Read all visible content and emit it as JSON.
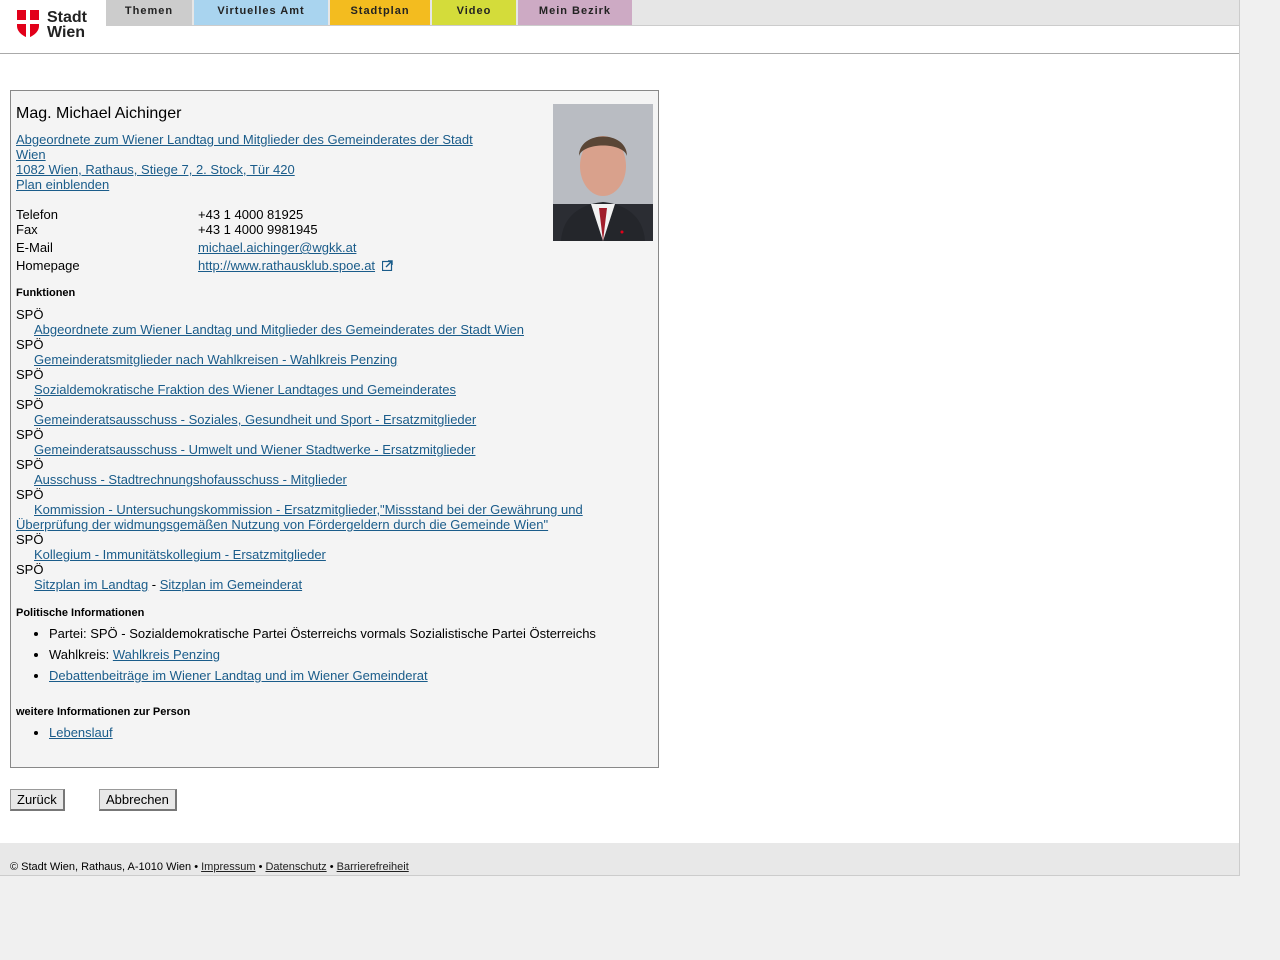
{
  "logo": {
    "line1": "Stadt",
    "line2": "Wien"
  },
  "nav": {
    "tabs": [
      {
        "label": "Themen",
        "color": "#cccccc"
      },
      {
        "label": "Virtuelles Amt",
        "color": "#a9d4ef"
      },
      {
        "label": "Stadtplan",
        "color": "#f3bc1f"
      },
      {
        "label": "Video",
        "color": "#d4dc3a"
      },
      {
        "label": "Mein Bezirk",
        "color": "#cdaac4"
      }
    ]
  },
  "person": {
    "name": "Mag. Michael Aichinger",
    "affiliation_line1": "Abgeordnete zum Wiener Landtag und Mitglieder des Gemeinderates der Stadt",
    "affiliation_line2": "Wien ",
    "address": "1082 Wien, Rathaus, Stiege 7, 2. Stock, Tür 420",
    "plan_link": "Plan einblenden",
    "contact": {
      "phone_label": "Telefon",
      "phone": "+43 1 4000 81925",
      "fax_label": "Fax",
      "fax": "+43 1 4000 9981945",
      "email_label": "E-Mail",
      "email": "michael.aichinger@wgkk.at",
      "homepage_label": "Homepage",
      "homepage": "http://www.rathausklub.spoe.at"
    }
  },
  "functions": {
    "heading": "Funktionen",
    "party": "SPÖ",
    "roles": [
      "Abgeordnete zum Wiener Landtag und Mitglieder des Gemeinderates der Stadt Wien",
      "Gemeinderatsmitglieder nach Wahlkreisen - Wahlkreis Penzing",
      "Sozialdemokratische Fraktion des Wiener Landtages und Gemeinderates",
      "Gemeinderatsausschuss - Soziales, Gesundheit und Sport - Ersatzmitglieder",
      "Gemeinderatsausschuss - Umwelt und Wiener Stadtwerke - Ersatzmitglieder",
      "Ausschuss - Stadtrechnungshofausschuss - Mitglieder"
    ],
    "role_long_line1": "Kommission - Untersuchungskommission - Ersatzmitglieder,\"Missstand bei der Gewährung und",
    "role_long_line2": "Überprüfung der widmungsgemäßen Nutzung von Fördergeldern durch die Gemeinde Wien\"",
    "role_last": "Kollegium - Immunitätskollegium - Ersatzmitglieder",
    "seat_landtag": "Sitzplan im Landtag",
    "seat_sep": " - ",
    "seat_gemeinderat": "Sitzplan im Gemeinderat"
  },
  "political": {
    "heading": "Politische Informationen",
    "party_label": "Partei:",
    "party_value": "SPÖ - Sozialdemokratische Partei Österreichs vormals Sozialistische Partei Österreichs",
    "district_label": "Wahlkreis:",
    "district_value": "Wahlkreis Penzing",
    "debates": "Debattenbeiträge im Wiener Landtag und im Wiener Gemeinderat"
  },
  "more": {
    "heading": "weitere Informationen zur Person",
    "cv": "Lebenslauf"
  },
  "buttons": {
    "back": "Zurück",
    "cancel": "Abbrechen"
  },
  "footer": {
    "copyright": "© Stadt Wien, Rathaus, A-1010 Wien",
    "sep": " • ",
    "impressum": "Impressum",
    "datenschutz": "Datenschutz",
    "barrierefreiheit": "Barrierefreiheit"
  }
}
